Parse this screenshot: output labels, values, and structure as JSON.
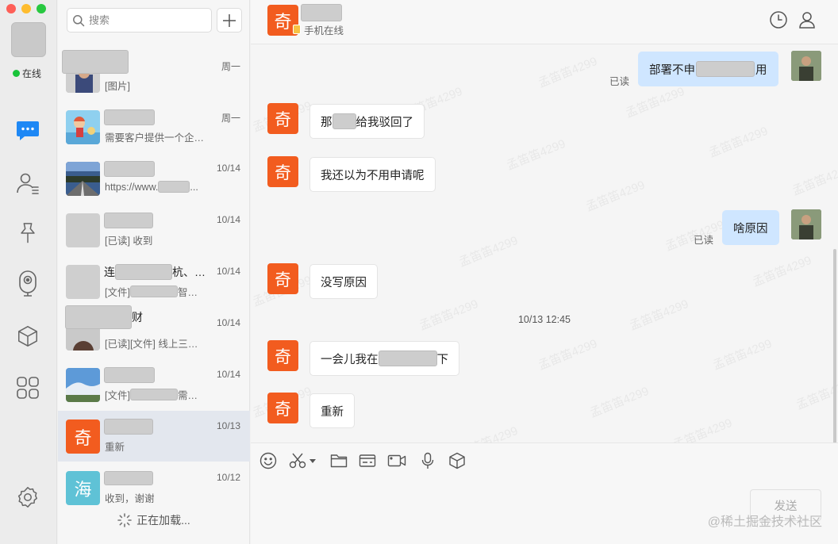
{
  "sidebar": {
    "status": "在线",
    "items": [
      {
        "icon": "chat-bubble-icon",
        "active": true
      },
      {
        "icon": "contacts-icon"
      },
      {
        "icon": "pin-icon"
      },
      {
        "icon": "camera-icon"
      },
      {
        "icon": "cube-icon"
      },
      {
        "icon": "apps-grid-icon"
      },
      {
        "icon": "gear-icon"
      }
    ],
    "accent": "#1e88f5"
  },
  "search": {
    "placeholder": "搜索"
  },
  "conversations": [
    {
      "preview": "[图片]",
      "time": "周一"
    },
    {
      "preview": "需要客户提供一个企…",
      "time": "周一"
    },
    {
      "preview": "https://www.",
      "preview_tail": "...",
      "time": "10/14"
    },
    {
      "preview": "[已读] 收到",
      "time": "10/14"
    },
    {
      "name_prefix": "连",
      "name_suffix": "杭、…",
      "preview": "[文件]",
      "preview_tail": "智…",
      "time": "10/14"
    },
    {
      "name_suffix": "财",
      "preview": "[已读][文件] 线上三…",
      "time": "10/14"
    },
    {
      "preview": "[文件]",
      "preview_tail": "需…",
      "time": "10/14"
    },
    {
      "avatar_text": "奇",
      "avatar_color": "#f25c1f",
      "preview": "重新",
      "time": "10/13",
      "active": true
    },
    {
      "avatar_text": "海",
      "avatar_color": "#5fc2d6",
      "preview": "收到，谢谢",
      "time": "10/12"
    }
  ],
  "loading_text": "正在加载...",
  "chat": {
    "avatar_text": "奇",
    "subtitle": "手机在线",
    "read_label": "已读",
    "timestamp": "10/13 12:45",
    "messages": [
      {
        "dir": "out",
        "text_pre": "部署不申",
        "text_post": "用"
      },
      {
        "dir": "in",
        "text_pre": "那",
        "text_post": "给我驳回了"
      },
      {
        "dir": "in",
        "text": "我还以为不用申请呢"
      },
      {
        "dir": "out",
        "text": "啥原因"
      },
      {
        "dir": "in",
        "text": "没写原因"
      },
      {
        "dir": "in",
        "text_pre": "一会儿我在",
        "text_post": "下"
      },
      {
        "dir": "in",
        "text": "重新"
      }
    ],
    "watermark": "孟笛笛4299",
    "send_label": "发送",
    "bubble_out_color": "#cfe6ff",
    "avatar_color": "#f25c1f"
  },
  "credit": "@稀土掘金技术社区"
}
